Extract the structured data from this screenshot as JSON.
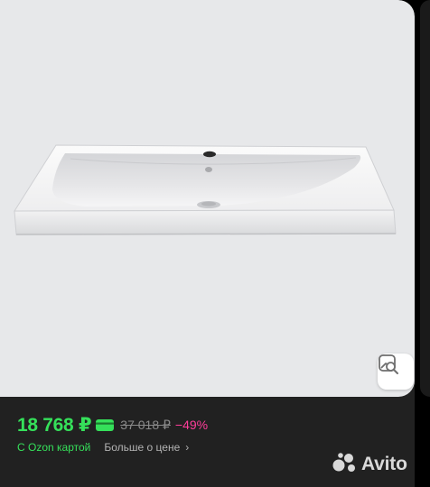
{
  "product": {
    "image_alt": "washbasin-photo",
    "price": "18 768 ₽",
    "old_price": "37 018 ₽",
    "discount": "−49%",
    "ozon_card_label": "С Ozon картой",
    "more_about_price": "Больше о цене",
    "chevron": "›"
  },
  "watermark": {
    "text": "Avito"
  },
  "icons": {
    "similar_search": "image-search-icon",
    "ozon_card": "bank-card-icon",
    "watermark_logo": "avito-logo-icon"
  },
  "colors": {
    "price_green": "#35e05a",
    "discount_pink": "#ff3d9a",
    "background": "#212121",
    "photo_bg": "#e7e8ea"
  }
}
